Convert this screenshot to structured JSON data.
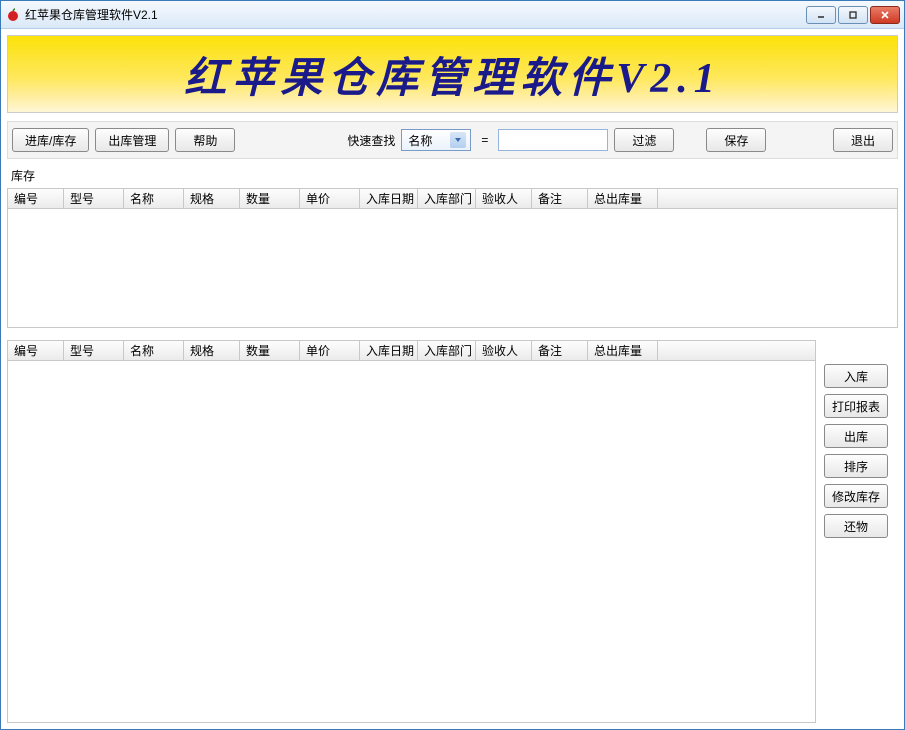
{
  "window": {
    "title": "红苹果仓库管理软件V2.1"
  },
  "banner": {
    "text": "红苹果仓库管理软件V2.1"
  },
  "toolbar": {
    "stock_in_btn": "进库/库存",
    "stock_out_mgmt_btn": "出库管理",
    "help_btn": "帮助",
    "quick_search_label": "快速查找",
    "search_field_selected": "名称",
    "equals": "=",
    "search_value": "",
    "filter_btn": "过滤",
    "save_btn": "保存",
    "exit_btn": "退出"
  },
  "section": {
    "inventory_label": "库存"
  },
  "grid_top": {
    "headers": [
      "编号",
      "型号",
      "名称",
      "规格",
      "数量",
      "单价",
      "入库日期",
      "入库部门",
      "验收人",
      "备注",
      "总出库量"
    ]
  },
  "grid_bottom": {
    "headers": [
      "编号",
      "型号",
      "名称",
      "规格",
      "数量",
      "单价",
      "入库日期",
      "入库部门",
      "验收人",
      "备注",
      "总出库量"
    ]
  },
  "side_buttons": {
    "in": "入库",
    "print": "打印报表",
    "out": "出库",
    "sort": "排序",
    "edit": "修改库存",
    "return_item": "还物"
  }
}
